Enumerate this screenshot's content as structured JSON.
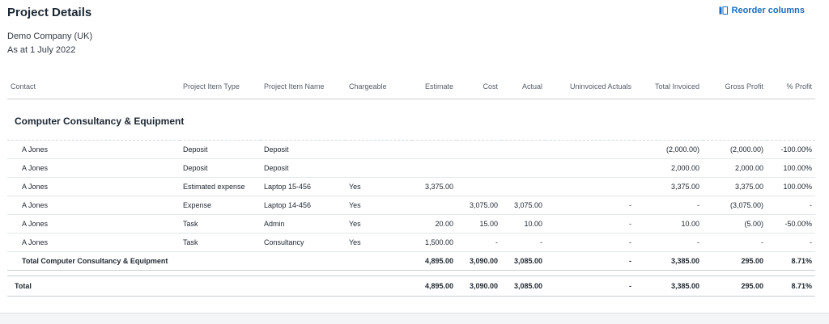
{
  "header": {
    "title": "Project Details",
    "company": "Demo Company (UK)",
    "as_at": "As at 1 July 2022",
    "reorder_label": "Reorder columns"
  },
  "columns": [
    "Contact",
    "Project Item Type",
    "Project Item Name",
    "Chargeable",
    "Estimate",
    "Cost",
    "Actual",
    "Uninvoiced Actuals",
    "Total Invoiced",
    "Gross Profit",
    "% Profit"
  ],
  "group": {
    "name": "Computer Consultancy & Equipment",
    "rows": [
      [
        "A Jones",
        "Deposit",
        "Deposit",
        "",
        "",
        "",
        "",
        "",
        "(2,000.00)",
        "(2,000.00)",
        "-100.00%"
      ],
      [
        "A Jones",
        "Deposit",
        "Deposit",
        "",
        "",
        "",
        "",
        "",
        "2,000.00",
        "2,000.00",
        "100.00%"
      ],
      [
        "A Jones",
        "Estimated expense",
        "Laptop 15-456",
        "Yes",
        "3,375.00",
        "",
        "",
        "",
        "3,375.00",
        "3,375.00",
        "100.00%"
      ],
      [
        "A Jones",
        "Expense",
        "Laptop 14-456",
        "Yes",
        "",
        "3,075.00",
        "3,075.00",
        "-",
        "-",
        "(3,075.00)",
        "-"
      ],
      [
        "A Jones",
        "Task",
        "Admin",
        "Yes",
        "20.00",
        "15.00",
        "10.00",
        "-",
        "10.00",
        "(5.00)",
        "-50.00%"
      ],
      [
        "A Jones",
        "Task",
        "Consultancy",
        "Yes",
        "1,500.00",
        "-",
        "-",
        "-",
        "-",
        "-",
        "-"
      ]
    ],
    "subtotal": [
      "Total Computer Consultancy & Equipment",
      "",
      "",
      "",
      "4,895.00",
      "3,090.00",
      "3,085.00",
      "-",
      "3,385.00",
      "295.00",
      "8.71%"
    ]
  },
  "total": [
    "Total",
    "",
    "",
    "",
    "4,895.00",
    "3,090.00",
    "3,085.00",
    "-",
    "3,385.00",
    "295.00",
    "8.71%"
  ]
}
